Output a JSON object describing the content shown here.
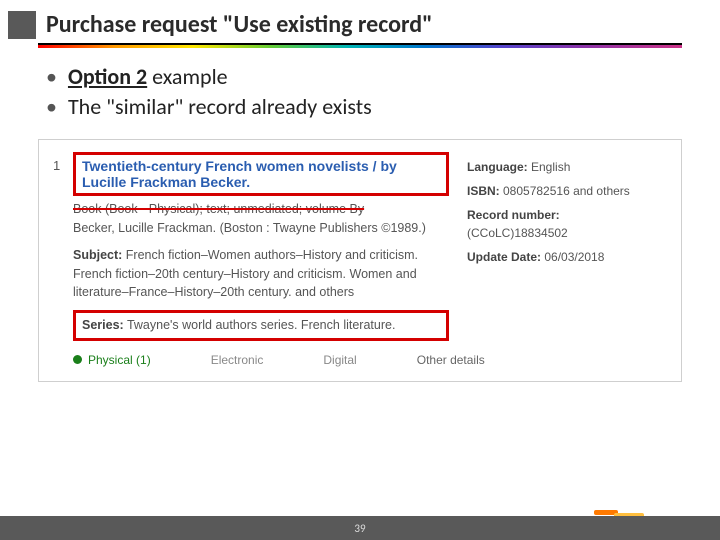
{
  "title": "Purchase request \"Use existing record\"",
  "bullets": {
    "b1_prefix": "Option 2",
    "b1_suffix": " example",
    "b2": "The \"similar\" record already exists"
  },
  "record": {
    "num": "1",
    "title": "Twentieth-century French women novelists / by Lucille Frackman Becker.",
    "type_line": "Book (Book - Physical); text; unmediated; volume By",
    "author_line": "Becker, Lucille Frackman. (Boston : Twayne Publishers ©1989.)",
    "subject_label": "Subject:",
    "subject_value": " French fiction–Women authors–History and criticism. French fiction–20th century–History and criticism. Women and literature–France–History–20th century. and others",
    "series_label": "Series:",
    "series_value": " Twayne's world authors series. French literature.",
    "lang_label": "Language:",
    "lang_value": " English",
    "isbn_label": "ISBN:",
    "isbn_value": " 0805782516 and others",
    "recno_label": "Record number:",
    "recno_value": " (CCoLC)18834502",
    "updated_label": "Update Date:",
    "updated_value": " 06/03/2018",
    "formats": {
      "physical": "Physical (1)",
      "electronic": "Electronic",
      "digital": "Digital",
      "other": "Other details"
    }
  },
  "page": "39"
}
